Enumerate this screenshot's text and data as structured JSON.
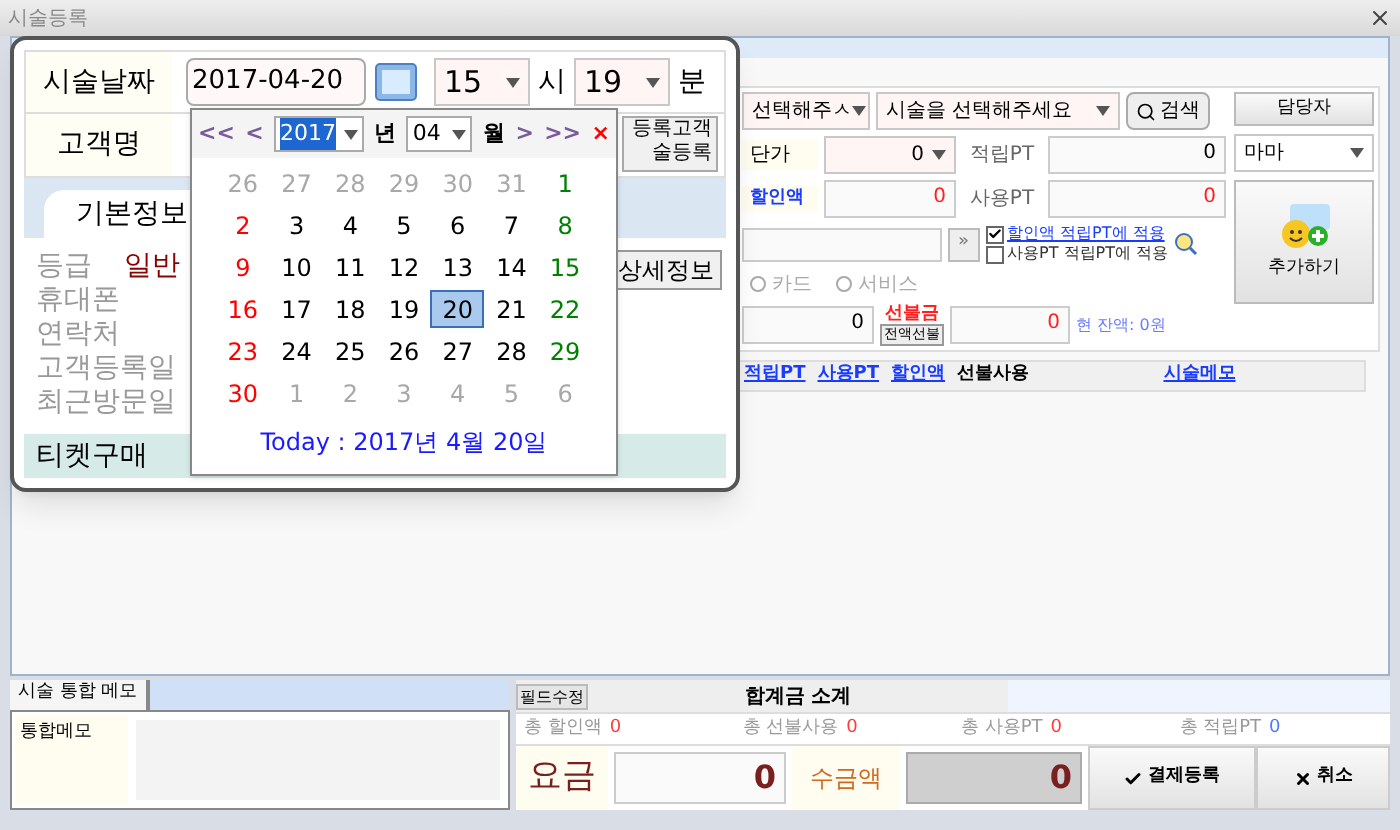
{
  "window": {
    "title": "시술등록"
  },
  "popup": {
    "date_label": "시술날짜",
    "date_value": "2017-04-20",
    "hour": "15",
    "hour_unit": "시",
    "minute": "19",
    "minute_unit": "분",
    "customer_label": "고객명",
    "register_button": [
      "등록고객",
      "술등록"
    ],
    "tabs": [
      {
        "label": "기본정보",
        "selected": true
      }
    ],
    "info": [
      {
        "label": "등급",
        "value": "일반"
      },
      {
        "label": "휴대폰"
      },
      {
        "label": "연락처"
      },
      {
        "label": "고객등록일"
      },
      {
        "label": "최근방문일"
      }
    ],
    "detail_button": "상세정보",
    "ticket_label": "티켓구매"
  },
  "calendar": {
    "prev": [
      "<<",
      "<"
    ],
    "year": "2017",
    "year_unit": "년",
    "month": "04",
    "month_unit": "월",
    "next": [
      ">",
      ">>"
    ],
    "close": "×",
    "days": [
      {
        "label": "26",
        "kind": "other",
        "selected": false
      },
      {
        "label": "27",
        "kind": "other",
        "selected": false
      },
      {
        "label": "28",
        "kind": "other",
        "selected": false
      },
      {
        "label": "29",
        "kind": "other",
        "selected": false
      },
      {
        "label": "30",
        "kind": "other",
        "selected": false
      },
      {
        "label": "31",
        "kind": "other",
        "selected": false
      },
      {
        "label": "1",
        "kind": "saturday",
        "selected": false
      },
      {
        "label": "2",
        "kind": "sunday",
        "selected": false
      },
      {
        "label": "3",
        "kind": "weekday",
        "selected": false
      },
      {
        "label": "4",
        "kind": "weekday",
        "selected": false
      },
      {
        "label": "5",
        "kind": "weekday",
        "selected": false
      },
      {
        "label": "6",
        "kind": "weekday",
        "selected": false
      },
      {
        "label": "7",
        "kind": "weekday",
        "selected": false
      },
      {
        "label": "8",
        "kind": "saturday",
        "selected": false
      },
      {
        "label": "9",
        "kind": "sunday",
        "selected": false
      },
      {
        "label": "10",
        "kind": "weekday",
        "selected": false
      },
      {
        "label": "11",
        "kind": "weekday",
        "selected": false
      },
      {
        "label": "12",
        "kind": "weekday",
        "selected": false
      },
      {
        "label": "13",
        "kind": "weekday",
        "selected": false
      },
      {
        "label": "14",
        "kind": "weekday",
        "selected": false
      },
      {
        "label": "15",
        "kind": "saturday",
        "selected": false
      },
      {
        "label": "16",
        "kind": "sunday",
        "selected": false
      },
      {
        "label": "17",
        "kind": "weekday",
        "selected": false
      },
      {
        "label": "18",
        "kind": "weekday",
        "selected": false
      },
      {
        "label": "19",
        "kind": "weekday",
        "selected": false
      },
      {
        "label": "20",
        "kind": "weekday",
        "selected": true
      },
      {
        "label": "21",
        "kind": "weekday",
        "selected": false
      },
      {
        "label": "22",
        "kind": "saturday",
        "selected": false
      },
      {
        "label": "23",
        "kind": "sunday",
        "selected": false
      },
      {
        "label": "24",
        "kind": "weekday",
        "selected": false
      },
      {
        "label": "25",
        "kind": "weekday",
        "selected": false
      },
      {
        "label": "26",
        "kind": "weekday",
        "selected": false
      },
      {
        "label": "27",
        "kind": "weekday",
        "selected": false
      },
      {
        "label": "28",
        "kind": "weekday",
        "selected": false
      },
      {
        "label": "29",
        "kind": "saturday",
        "selected": false
      },
      {
        "label": "30",
        "kind": "sunday",
        "selected": false
      },
      {
        "label": "1",
        "kind": "other",
        "selected": false
      },
      {
        "label": "2",
        "kind": "other",
        "selected": false
      },
      {
        "label": "3",
        "kind": "other",
        "selected": false
      },
      {
        "label": "4",
        "kind": "other",
        "selected": false
      },
      {
        "label": "5",
        "kind": "other",
        "selected": false
      },
      {
        "label": "6",
        "kind": "other",
        "selected": false
      }
    ],
    "today": "Today : 2017년 4월 20일"
  },
  "form": {
    "select_1": "선택해주ㅅ",
    "select_2": "시술을 선택해주세요",
    "search_button": "검색",
    "staff_button": "담당자",
    "price_label": "단가",
    "price_value": "0",
    "earn_pt_label": "적립PT",
    "earn_pt_value": "0",
    "staff_value": "마마",
    "discount_label": "할인액",
    "discount_value": "0",
    "use_pt_label": "사용PT",
    "use_pt_value": "0",
    "add_button": "추가하기",
    "more_button": "»",
    "checkboxes": [
      {
        "label": "할인액 적립PT에 적용",
        "checked": true
      },
      {
        "label": "사용PT 적립PT에 적용",
        "checked": false
      }
    ],
    "radios": [
      {
        "label": "카드",
        "selected": false
      },
      {
        "label": "서비스",
        "selected": false
      }
    ],
    "amount_value": "0",
    "prepaid_label": "선불금",
    "prepaid_button": "전액선불",
    "prepaid_value": "0",
    "balance": "현 잔액: 0원"
  },
  "table": {
    "columns": [
      {
        "label": "적립PT",
        "link": true
      },
      {
        "label": "사용PT",
        "link": true
      },
      {
        "label": "할인액",
        "link": true
      },
      {
        "label": "선불사용",
        "link": false
      },
      {
        "label": "시술메모",
        "link": true
      }
    ]
  },
  "memo": {
    "tab": "시술 통합 메모",
    "label": "통합메모"
  },
  "summary": {
    "edit_button": "필드수정",
    "title": "합계금 소계",
    "stats": [
      {
        "label": "총 할인액",
        "value": "0",
        "color": "#ff3b3b"
      },
      {
        "label": "총 선불사용",
        "value": "0",
        "color": "#ff3b3b"
      },
      {
        "label": "총 사용PT",
        "value": "0",
        "color": "#ff3b3b"
      },
      {
        "label": "총 적립PT",
        "value": "0",
        "color": "#4a7dff"
      }
    ],
    "fee_label": "요금",
    "fee_value": "0",
    "received_label": "수금액",
    "received_value": "0",
    "pay_button": "결제등록",
    "cancel_button": "취소"
  }
}
